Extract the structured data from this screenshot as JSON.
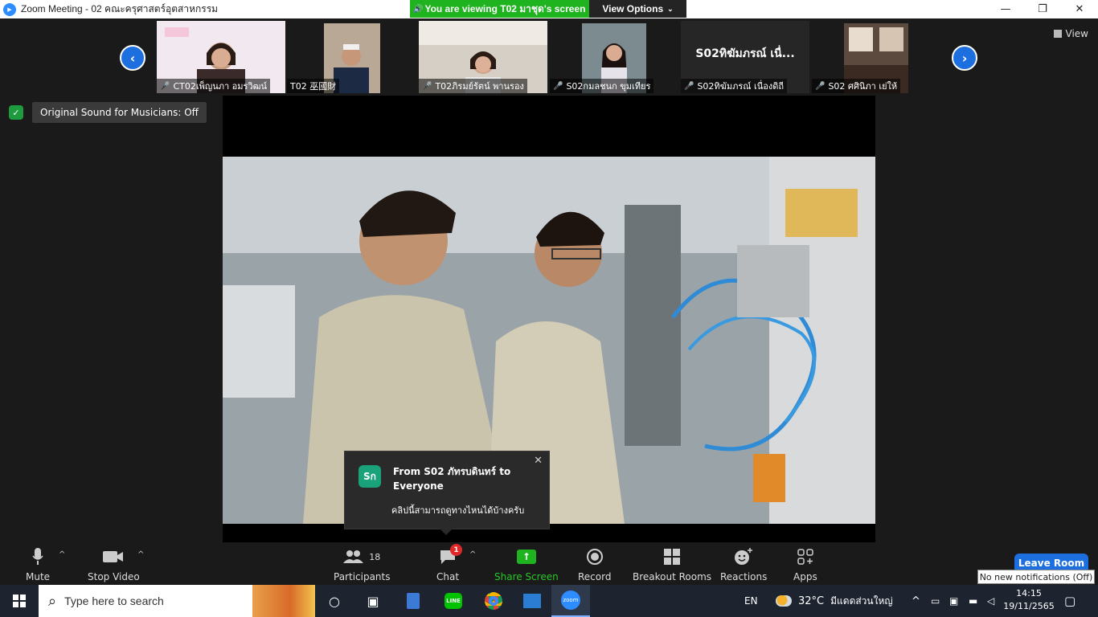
{
  "titlebar": {
    "title": "Zoom Meeting - 02 คณะครุศาสตร์อุตสาหกรรม",
    "viewing_banner": "You are viewing T02 มาชุด's screen",
    "view_options": "View Options"
  },
  "window_controls": [
    "—",
    "❐",
    "✕"
  ],
  "filmstrip": {
    "view_label": "View",
    "tiles": [
      {
        "name": "CT02เพ็ญนภา  อมรวิฒน์",
        "muted": true
      },
      {
        "name": "T02 巫國財",
        "muted": false
      },
      {
        "name": "T02ภิรมย์รัตน์ พานรอง",
        "muted": true
      },
      {
        "name": "S02กมลชนก ขุมเทียร",
        "muted": true
      },
      {
        "name": "S02ทิฆัมภรณ์ เนื่องดิถี",
        "muted": true,
        "big_name": "S02ทิฆัมภรณ์ เนื่..."
      },
      {
        "name": "S02 ศศินิภา เย่ให้",
        "muted": true
      }
    ]
  },
  "original_sound": "Original Sound for Musicians: Off",
  "chat_popup": {
    "avatar": "Sก",
    "from": "From S02 ภัทรบดินทร์ to Everyone",
    "message": "คลิปนี้สามารถดูทางไหนได้บ้างครับ"
  },
  "toolbar": {
    "mute": "Mute",
    "stop_video": "Stop Video",
    "participants": "Participants",
    "participants_count": "18",
    "chat": "Chat",
    "chat_badge": "1",
    "share_screen": "Share Screen",
    "record": "Record",
    "breakout_rooms": "Breakout Rooms",
    "reactions": "Reactions",
    "apps": "Apps",
    "leave_room": "Leave Room",
    "notification": "No new notifications (Off)"
  },
  "taskbar": {
    "search_placeholder": "Type here to search",
    "language": "EN",
    "weather_temp": "32°C",
    "weather_text": "มีแดดส่วนใหญ่",
    "time": "14:15",
    "date": "19/11/2565"
  },
  "colors": {
    "accent_blue": "#1d6fe0",
    "share_green": "#1fb31f",
    "muted_red": "#e02828"
  }
}
